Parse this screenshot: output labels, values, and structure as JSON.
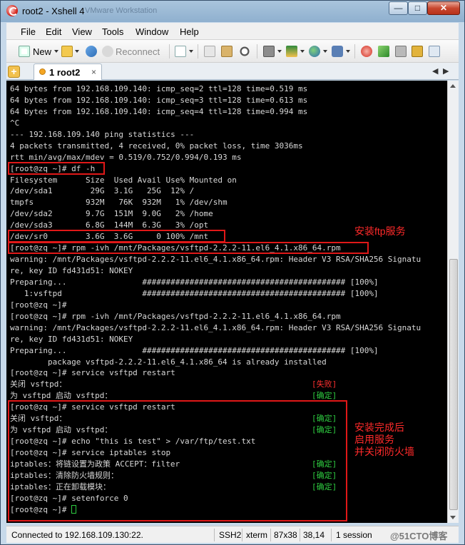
{
  "window": {
    "title": "root2 - Xshell 4",
    "background_title": "VMware Workstation"
  },
  "menu": [
    "File",
    "Edit",
    "View",
    "Tools",
    "Window",
    "Help"
  ],
  "toolbar": {
    "new_label": "New",
    "reconnect_label": "Reconnect"
  },
  "tab": {
    "label": "1 root2",
    "close": "×"
  },
  "terminal": {
    "lines": [
      "64 bytes from 192.168.109.140: icmp_seq=2 ttl=128 time=0.519 ms",
      "64 bytes from 192.168.109.140: icmp_seq=3 ttl=128 time=0.613 ms",
      "64 bytes from 192.168.109.140: icmp_seq=4 ttl=128 time=0.994 ms",
      "^C",
      "--- 192.168.109.140 ping statistics ---",
      "4 packets transmitted, 4 received, 0% packet loss, time 3036ms",
      "rtt min/avg/max/mdev = 0.519/0.752/0.994/0.193 ms",
      "[root@zq ~]# df -h",
      "Filesystem      Size  Used Avail Use% Mounted on",
      "/dev/sda1        29G  3.1G   25G  12% /",
      "tmpfs           932M   76K  932M   1% /dev/shm",
      "/dev/sda2       9.7G  151M  9.0G   2% /home",
      "/dev/sda3       6.8G  144M  6.3G   3% /opt",
      "/dev/sr0        3.6G  3.6G     0 100% /mnt",
      "[root@zq ~]# rpm -ivh /mnt/Packages/vsftpd-2.2.2-11.el6_4.1.x86_64.rpm",
      "warning: /mnt/Packages/vsftpd-2.2.2-11.el6_4.1.x86_64.rpm: Header V3 RSA/SHA256 Signatu",
      "re, key ID fd431d51: NOKEY",
      "Preparing...                ########################################### [100%]",
      "   1:vsftpd                 ########################################### [100%]",
      "[root@zq ~]#",
      "[root@zq ~]# rpm -ivh /mnt/Packages/vsftpd-2.2.2-11.el6_4.1.x86_64.rpm",
      "warning: /mnt/Packages/vsftpd-2.2.2-11.el6_4.1.x86_64.rpm: Header V3 RSA/SHA256 Signatu",
      "re, key ID fd431d51: NOKEY",
      "Preparing...                ########################################### [100%]",
      "        package vsftpd-2.2.2-11.el6_4.1.x86_64 is already installed",
      "[root@zq ~]# service vsftpd restart",
      "关闭 vsftpd：",
      "为 vsftpd 启动 vsftpd：",
      "[root@zq ~]# service vsftpd restart",
      "关闭 vsftpd：",
      "为 vsftpd 启动 vsftpd：",
      "[root@zq ~]# echo \"this is test\" > /var/ftp/test.txt",
      "[root@zq ~]# service iptables stop",
      "iptables：将链设置为政策 ACCEPT：filter",
      "iptables：清除防火墙规则：",
      "iptables：正在卸载模块：",
      "[root@zq ~]# setenforce 0",
      "[root@zq ~]# "
    ],
    "status_tags": [
      {
        "line": 26,
        "text": "[失败]",
        "color": "#ff3030"
      },
      {
        "line": 27,
        "text": "[确定]",
        "color": "#2ecc40"
      },
      {
        "line": 29,
        "text": "[确定]",
        "color": "#2ecc40"
      },
      {
        "line": 30,
        "text": "[确定]",
        "color": "#2ecc40"
      },
      {
        "line": 33,
        "text": "[确定]",
        "color": "#2ecc40"
      },
      {
        "line": 34,
        "text": "[确定]",
        "color": "#2ecc40"
      },
      {
        "line": 35,
        "text": "[确定]",
        "color": "#2ecc40"
      }
    ]
  },
  "annotations": {
    "install_ftp": "安装ftp服务",
    "after_install": "安装完成后\n启用服务\n并关闭防火墙"
  },
  "status": {
    "connection": "Connected to 192.168.109.130:22.",
    "protocol": "SSH2",
    "term": "xterm",
    "size": "87x38",
    "pos": "38,14",
    "sessions": "1 session",
    "watermark": "@51CTO博客"
  }
}
